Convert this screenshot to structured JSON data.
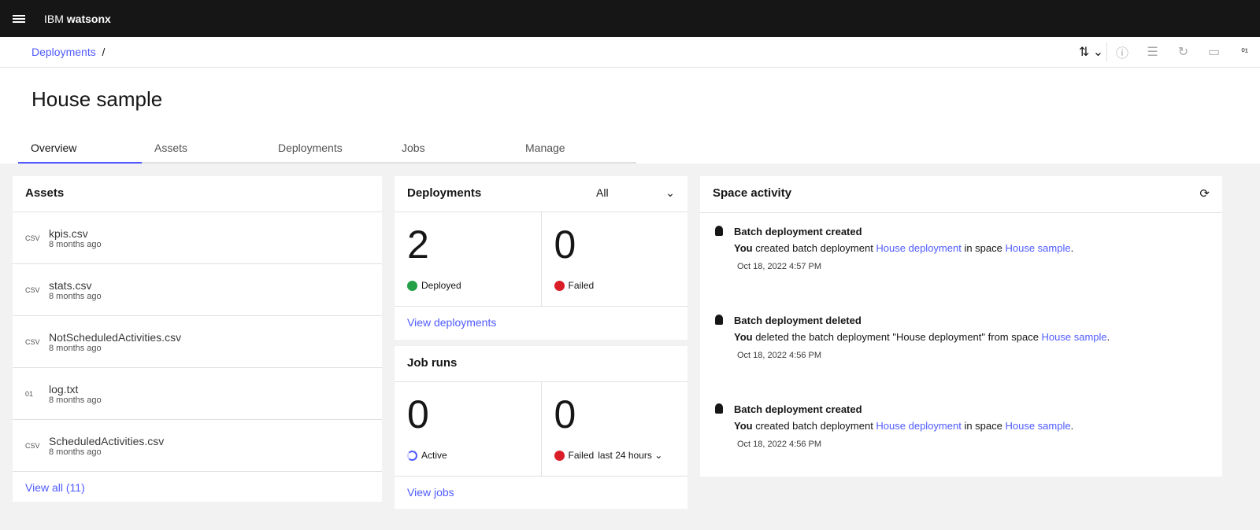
{
  "app": {
    "brand_prefix": "IBM",
    "brand_name": "watsonx"
  },
  "breadcrumb": {
    "link": "Deployments",
    "sep": "/"
  },
  "title": "House sample",
  "tabs": [
    "Overview",
    "Assets",
    "Deployments",
    "Jobs",
    "Manage"
  ],
  "assets": {
    "title": "Assets",
    "items": [
      {
        "icon": "CSV",
        "name": "kpis.csv",
        "time": "8 months ago"
      },
      {
        "icon": "CSV",
        "name": "stats.csv",
        "time": "8 months ago"
      },
      {
        "icon": "CSV",
        "name": "NotScheduledActivities.csv",
        "time": "8 months ago"
      },
      {
        "icon": "01",
        "name": "log.txt",
        "time": "8 months ago"
      },
      {
        "icon": "CSV",
        "name": "ScheduledActivities.csv",
        "time": "8 months ago"
      }
    ],
    "view_all": "View all (11)"
  },
  "deployments": {
    "title": "Deployments",
    "filter": "All",
    "deployed": "2",
    "deployed_label": "Deployed",
    "failed": "0",
    "failed_label": "Failed",
    "link": "View deployments"
  },
  "jobs": {
    "title": "Job runs",
    "active": "0",
    "active_label": "Active",
    "failed": "0",
    "failed_label": "Failed",
    "failed_period": "last 24 hours",
    "link": "View jobs"
  },
  "activity": {
    "title": "Space activity",
    "items": [
      {
        "title": "Batch deployment created",
        "who": "You",
        "pre": " created batch deployment ",
        "link1": "House deployment",
        "mid": " in space ",
        "link2": "House sample",
        "post": ".",
        "time": "Oct 18, 2022 4:57 PM"
      },
      {
        "title": "Batch deployment deleted",
        "who": "You",
        "pre": " deleted the batch deployment \"House deployment\" from space ",
        "link1": "",
        "mid": "",
        "link2": "House sample",
        "post": ".",
        "time": "Oct 18, 2022 4:56 PM"
      },
      {
        "title": "Batch deployment created",
        "who": "You",
        "pre": " created batch deployment ",
        "link1": "House deployment",
        "mid": " in space ",
        "link2": "House sample",
        "post": ".",
        "time": "Oct 18, 2022 4:56 PM"
      }
    ]
  }
}
